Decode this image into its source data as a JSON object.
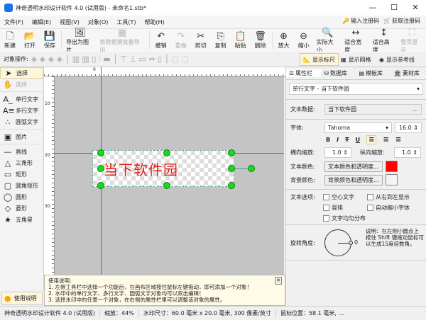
{
  "window": {
    "title": "神奇透明水印设计软件 4.0 (试用版) - 未命名1.stb*",
    "minimize": "—",
    "maximize": "☐",
    "close": "✕"
  },
  "menu": [
    "文件(F)",
    "编辑(E)",
    "视图(V)",
    "对象(O)",
    "工具(T)",
    "帮助(H)"
  ],
  "register": {
    "enter": "输入注册码",
    "get": "获取注册码"
  },
  "toolbar": [
    {
      "label": "新建",
      "icon": "🗋",
      "enabled": true
    },
    {
      "label": "打开",
      "icon": "📂",
      "enabled": true
    },
    {
      "label": "保存",
      "icon": "💾",
      "enabled": true
    },
    {
      "label": "导出为图片",
      "icon": "🖼",
      "enabled": true
    },
    {
      "label": "依数据源批量导出",
      "icon": "▦",
      "enabled": false
    },
    {
      "label": "撤销",
      "icon": "↶",
      "enabled": true
    },
    {
      "label": "重做",
      "icon": "↷",
      "enabled": false
    },
    {
      "label": "剪切",
      "icon": "✂",
      "enabled": true
    },
    {
      "label": "复制",
      "icon": "⎘",
      "enabled": true
    },
    {
      "label": "粘贴",
      "icon": "📋",
      "enabled": true
    },
    {
      "label": "删除",
      "icon": "🗑",
      "enabled": true
    },
    {
      "label": "放大",
      "icon": "⊕",
      "enabled": true
    },
    {
      "label": "缩小",
      "icon": "⊖",
      "enabled": true
    },
    {
      "label": "实际大小",
      "icon": "🔍",
      "enabled": true
    },
    {
      "label": "适合宽度",
      "icon": "↔",
      "enabled": true
    },
    {
      "label": "适合高度",
      "icon": "↕",
      "enabled": true
    },
    {
      "label": "整页显示",
      "icon": "⛶",
      "enabled": false
    }
  ],
  "objbar": {
    "label": "对象操作:",
    "show_ruler": "显示标尺",
    "show_grid": "显示网格",
    "show_guides": "显示参考线"
  },
  "tools": [
    {
      "label": "选择",
      "icon": "➤"
    },
    {
      "label": "选择",
      "icon": "✋"
    },
    {
      "label": "单行文字",
      "icon": "A_"
    },
    {
      "label": "多行文字",
      "icon": "A≡"
    },
    {
      "label": "圆弧文字",
      "icon": "∴"
    },
    {
      "label": "图片",
      "icon": "▣"
    },
    {
      "label": "直线",
      "icon": "—"
    },
    {
      "label": "三角形",
      "icon": "△"
    },
    {
      "label": "矩形",
      "icon": "▭"
    },
    {
      "label": "圆角矩形",
      "icon": "▢"
    },
    {
      "label": "圆形",
      "icon": "◯"
    },
    {
      "label": "菱形",
      "icon": "◇"
    },
    {
      "label": "五角星",
      "icon": "★"
    }
  ],
  "ruler": {
    "h0": "0",
    "v1": "10",
    "v2": "20",
    "v3": "30"
  },
  "watermark": {
    "text": "当下软件园",
    "color": "#e0201c"
  },
  "help": {
    "title": "使用说明:",
    "lines": [
      "1. 左侧工具栏中选择一个功能后，在画布区域按住鼠标左键拖动，即可添加一个对象！",
      "2. 水印中的单行文字、多行文字、圆弧文字对象均可以双击编辑！",
      "3. 选择水印中的任意一个对象，在右侧的属性栏里可以调整该对象的属性。"
    ],
    "button": "使用说明",
    "close": "✕"
  },
  "status": {
    "app": "神奇透明水印设计软件 4.0 (试用版)",
    "zoom": "缩放：44%",
    "size": "水印尺寸：60.0 毫米 x 20.0 毫米, 300 像素/英寸",
    "pos": "鼠标位置：58.1 毫米, ..."
  },
  "panel": {
    "tabs": [
      "属性栏",
      "数据库",
      "模板库",
      "素材库"
    ],
    "object": "单行文字 - 当下软件园",
    "text_data_label": "文本数据:",
    "text_data": "当下软件园",
    "more": "...",
    "font_label": "字体:",
    "font": "Tahoma",
    "font_size": "16.0",
    "styles": [
      "B",
      "I",
      "T",
      "U"
    ],
    "hscale_label": "横向缩放:",
    "hscale": "1.0",
    "vscale_label": "纵向缩放:",
    "vscale": "1.0",
    "text_color_label": "文本颜色:",
    "text_color_btn": "文本颜色和透明度...",
    "text_color": "#ff0000",
    "bg_color_label": "背景颜色:",
    "bg_color_btn": "背景颜色和透明度...",
    "bg_color": "#f4f4f4",
    "options_label": "文本选项:",
    "options": [
      {
        "label": "空心文字",
        "checked": false
      },
      {
        "label": "从右到左显示",
        "checked": false
      },
      {
        "label": "竖排",
        "checked": false
      },
      {
        "label": "自动缩小字体",
        "checked": false
      },
      {
        "label": "文字均匀分布",
        "checked": false
      }
    ],
    "rotation_label": "旋转角度:",
    "rotation": "0",
    "rotation_note": "说明：在左侧小圆点上按住 Shift 键拖动鼠标可以生成15度倍数角。"
  }
}
